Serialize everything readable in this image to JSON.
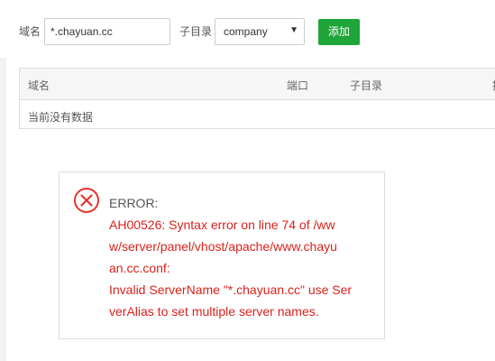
{
  "form": {
    "domain_label": "域名",
    "domain_value": "*.chayuan.cc",
    "subdir_label": "子目录",
    "subdir_selected": "company",
    "add_button": "添加"
  },
  "table": {
    "columns": [
      "域名",
      "端口",
      "子目录",
      "操"
    ],
    "empty_text": "当前没有数据"
  },
  "error": {
    "title": "ERROR:",
    "lines": [
      "AH00526: Syntax error on line 74 of /ww",
      "w/server/panel/vhost/apache/www.chayu",
      "an.cc.conf:",
      "Invalid ServerName \"*.chayuan.cc\" use Ser",
      "verAlias to set multiple server names."
    ]
  },
  "colors": {
    "accent_green": "#20a53a",
    "error_red": "#d9221b"
  }
}
